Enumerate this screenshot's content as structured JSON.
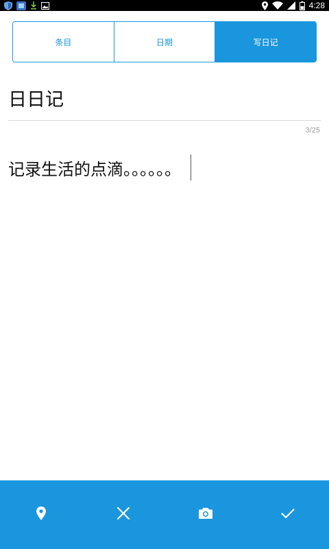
{
  "status_bar": {
    "time": "4:28",
    "icons_left": [
      "shield-icon",
      "app-icon",
      "download-icon",
      "image-icon"
    ],
    "icons_right": [
      "location-icon",
      "wifi-icon",
      "signal-icon",
      "battery-icon"
    ]
  },
  "tabs": [
    {
      "label": "条目",
      "active": false
    },
    {
      "label": "日期",
      "active": false
    },
    {
      "label": "写日记",
      "active": true
    }
  ],
  "editor": {
    "title": "日日记",
    "counter": "3/25",
    "body": "记录生活的点滴。。。。。。"
  },
  "bottom_bar": {
    "icons": [
      "location-pin-icon",
      "close-icon",
      "camera-icon",
      "check-icon"
    ]
  },
  "colors": {
    "accent": "#1a96de",
    "text": "#111111",
    "counter": "#9e9e9e",
    "divider": "#d9d9d9"
  }
}
